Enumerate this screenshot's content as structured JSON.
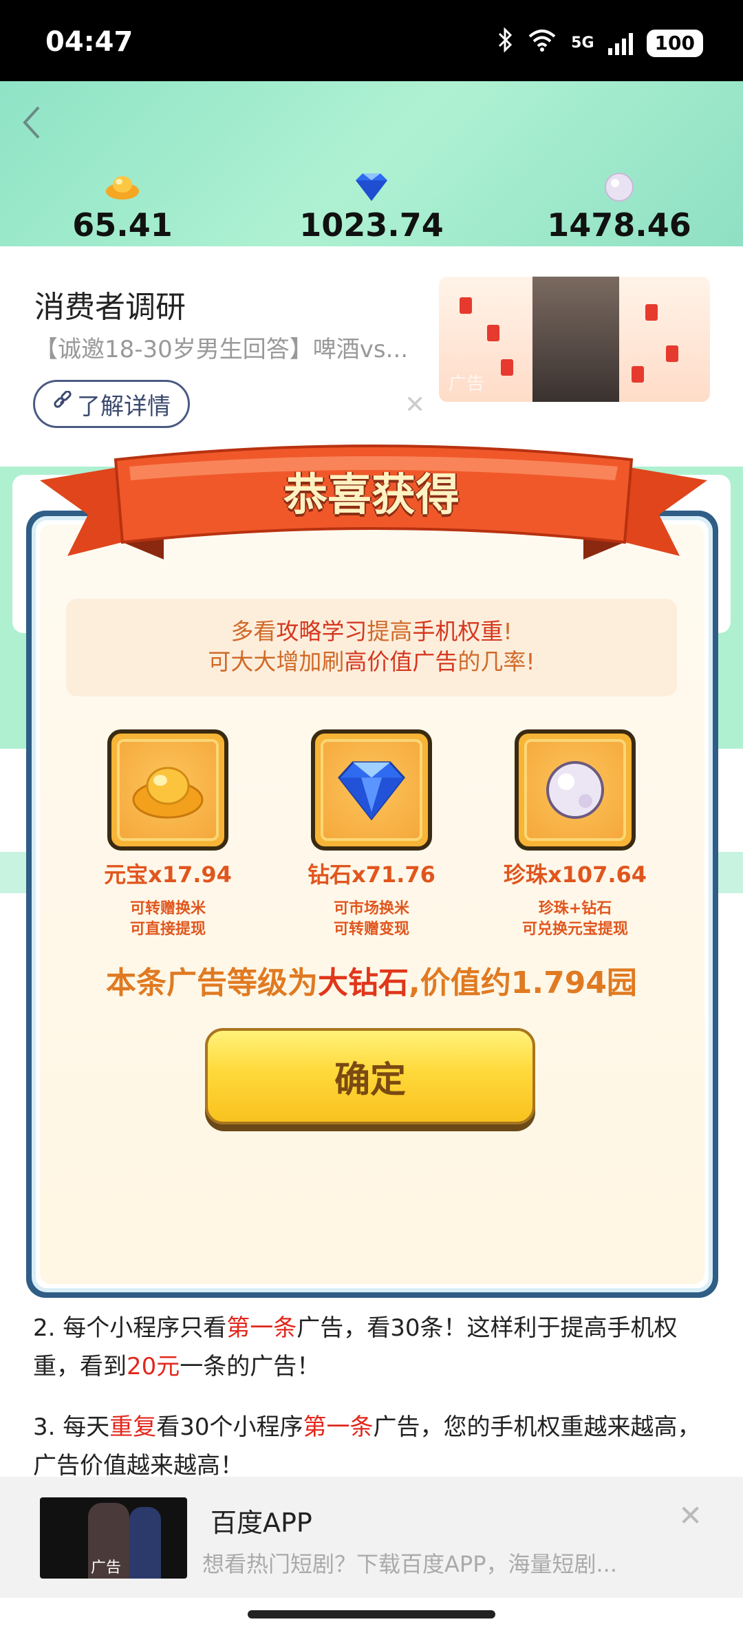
{
  "status": {
    "time": "04:47",
    "network": "5G",
    "battery": "100"
  },
  "balances": [
    {
      "icon": "gold-ingot-icon",
      "value": "65.41"
    },
    {
      "icon": "diamond-icon",
      "value": "1023.74"
    },
    {
      "icon": "pearl-icon",
      "value": "1478.46"
    }
  ],
  "ad": {
    "title": "消费者调研",
    "desc": "【诚邀18-30岁男生回答】啤酒vs...",
    "button": "了解详情",
    "close": "✕",
    "image_tag": "广告"
  },
  "modal": {
    "title": "恭喜获得",
    "tip_line1_a": "多看",
    "tip_line1_b": "攻略学习",
    "tip_line1_c": "提高",
    "tip_line1_d": "手机权重",
    "tip_line1_e": "!",
    "tip_line2_a": "可大大增加刷",
    "tip_line2_b": "高价值广告",
    "tip_line2_c": "的几率!",
    "rewards": [
      {
        "icon": "gold-ingot-icon",
        "name": "元宝",
        "amount": "x17.94",
        "sub1": "可转赠换米",
        "sub2": "可直接提现"
      },
      {
        "icon": "diamond-icon",
        "name": "钻石",
        "amount": "x71.76",
        "sub1": "可市场换米",
        "sub2": "可转赠变现"
      },
      {
        "icon": "pearl-icon",
        "name": "珍珠",
        "amount": "x107.64",
        "sub1": "珍珠+钻石",
        "sub2": "可兑换元宝提现"
      }
    ],
    "level_a": "本条广告等级为",
    "level_b": "大钻石",
    "level_c": ",价值约1.794园",
    "confirm": "确定"
  },
  "tips": {
    "t2_a": "2. 每个小程序只看",
    "t2_b": "第一条",
    "t2_c": "广告，看30条！这样利于提高手机权重，看到",
    "t2_d": "20元",
    "t2_e": "一条的广告！",
    "t3_a": "3. 每天",
    "t3_b": "重复",
    "t3_c": "看30个小程序",
    "t3_d": "第一条",
    "t3_e": "广告，您的手机权重越来越高，广告价值越来越高！"
  },
  "bottom_ad": {
    "title": "百度APP",
    "desc": "想看热门短剧？下载百度APP，海量短剧...",
    "thumb_tag": "广告",
    "close": "✕"
  }
}
